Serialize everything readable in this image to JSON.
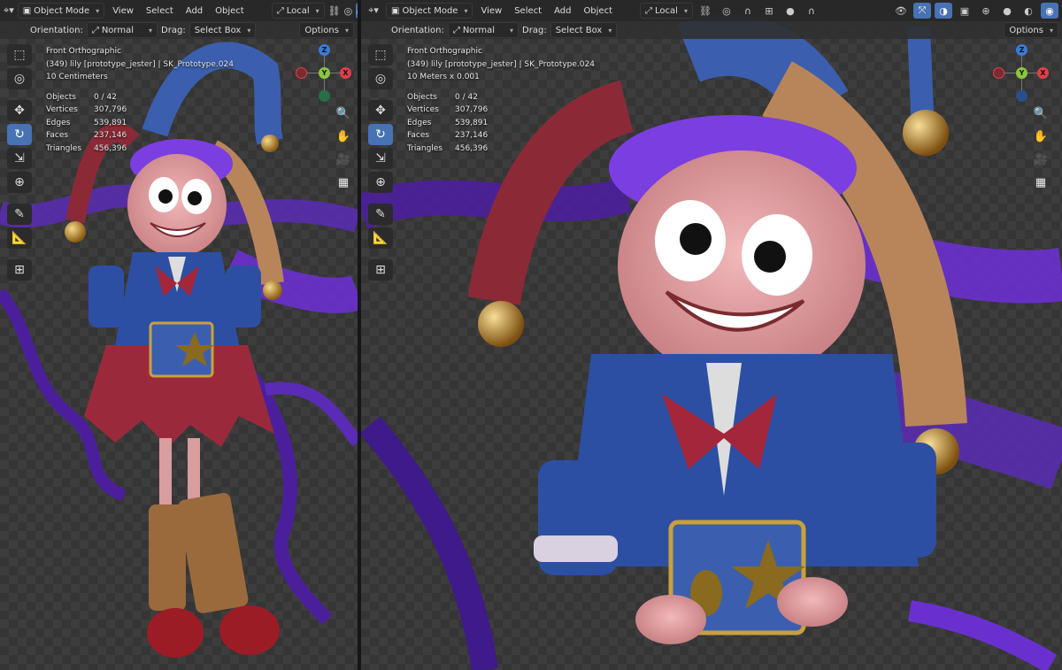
{
  "header": {
    "mode": "Object Mode",
    "menus": [
      "View",
      "Select",
      "Add",
      "Object"
    ],
    "transform_orientation": "Local",
    "orientation_label": "Orientation:",
    "orientation_value": "Normal",
    "drag_label": "Drag:",
    "drag_value": "Select Box",
    "options": "Options"
  },
  "left_viewport": {
    "view_name": "Front Orthographic",
    "object_line": "(349) lily [prototype_jester] | SK_Prototype.024",
    "scale": "10 Centimeters"
  },
  "right_viewport": {
    "view_name": "Front Orthographic",
    "object_line": "(349) lily [prototype_jester] | SK_Prototype.024",
    "scale": "10 Meters x 0.001"
  },
  "stats": {
    "objects_label": "Objects",
    "objects_value": "0 / 42",
    "vertices_label": "Vertices",
    "vertices_value": "307,796",
    "edges_label": "Edges",
    "edges_value": "539,891",
    "faces_label": "Faces",
    "faces_value": "237,146",
    "triangles_label": "Triangles",
    "triangles_value": "456,396"
  },
  "gizmo_axes": {
    "x": "X",
    "y": "Y",
    "z": "Z"
  },
  "colors": {
    "accent": "#4772b3",
    "axis_x": "#e0404a",
    "axis_y": "#8cc63f",
    "axis_z": "#3a7bd5"
  },
  "tools": [
    "select-box-icon",
    "cursor-icon",
    "move-icon",
    "rotate-icon",
    "scale-icon",
    "transform-icon",
    "annotate-icon",
    "measure-icon",
    "add-cube-icon"
  ],
  "nav_icons": [
    "zoom-icon",
    "pan-hand-icon",
    "camera-icon",
    "grid-icon"
  ]
}
